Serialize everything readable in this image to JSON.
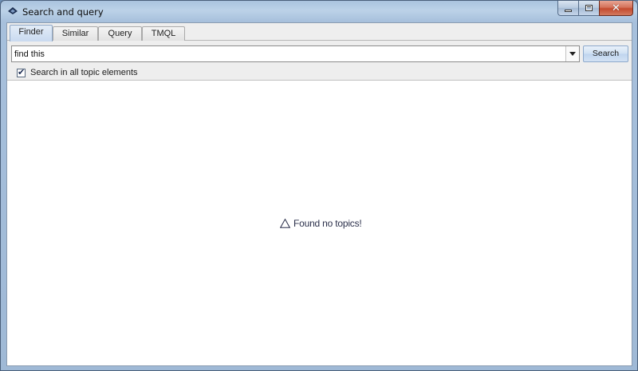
{
  "window": {
    "title": "Search and query",
    "icon": "topic-map-app-icon"
  },
  "caption_buttons": {
    "minimize": "minimize-icon",
    "maximize": "maximize-icon",
    "close_glyph": "✕"
  },
  "tabs": [
    {
      "label": "Finder",
      "active": true
    },
    {
      "label": "Similar",
      "active": false
    },
    {
      "label": "Query",
      "active": false
    },
    {
      "label": "TMQL",
      "active": false
    }
  ],
  "search": {
    "value": "find this",
    "button_label": "Search"
  },
  "options": {
    "search_all_label": "Search in all topic elements",
    "search_all_checked": true
  },
  "results": {
    "message": "Found no topics!",
    "icon": "warning-icon"
  }
}
